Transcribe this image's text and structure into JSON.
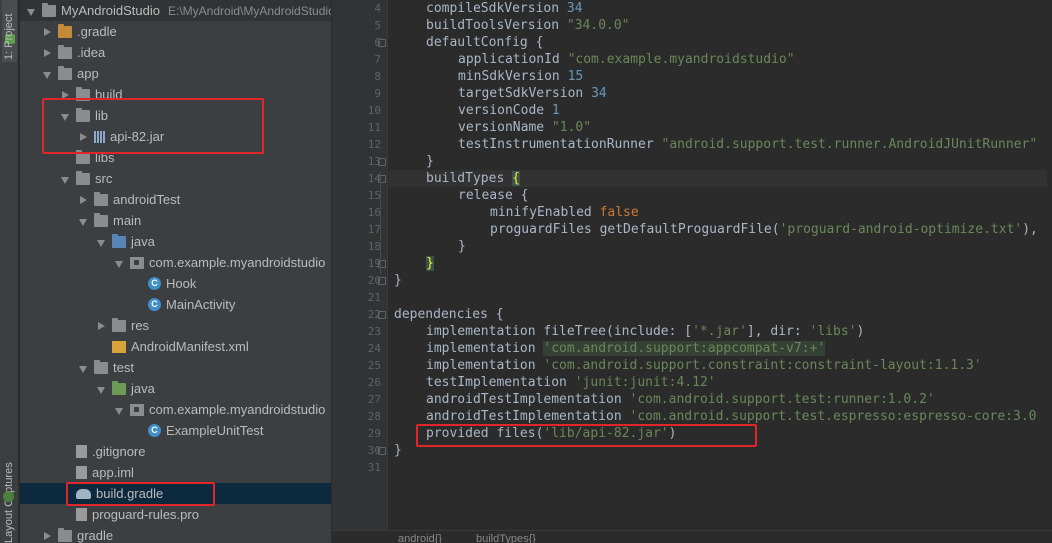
{
  "tool_strip": {
    "project_tab": "1: Project",
    "layout_captures_tab": "Layout Captures"
  },
  "project_tree": {
    "root": {
      "name": "MyAndroidStudio",
      "path": "E:\\MyAndroid\\MyAndroidStudio"
    },
    "rows": [
      {
        "label": ".gradle"
      },
      {
        "label": ".idea"
      },
      {
        "label": "app"
      },
      {
        "label": "build"
      },
      {
        "label": "lib"
      },
      {
        "label": "api-82.jar"
      },
      {
        "label": "libs"
      },
      {
        "label": "src"
      },
      {
        "label": "androidTest"
      },
      {
        "label": "main"
      },
      {
        "label": "java"
      },
      {
        "label": "com.example.myandroidstudio"
      },
      {
        "label": "Hook"
      },
      {
        "label": "MainActivity"
      },
      {
        "label": "res"
      },
      {
        "label": "AndroidManifest.xml"
      },
      {
        "label": "test"
      },
      {
        "label": "java"
      },
      {
        "label": "com.example.myandroidstudio"
      },
      {
        "label": "ExampleUnitTest"
      },
      {
        "label": ".gitignore"
      },
      {
        "label": "app.iml"
      },
      {
        "label": "build.gradle"
      },
      {
        "label": "proguard-rules.pro"
      },
      {
        "label": "gradle"
      }
    ],
    "class_badge": "C"
  },
  "editor": {
    "line_numbers": [
      "4",
      "5",
      "6",
      "7",
      "8",
      "9",
      "10",
      "11",
      "12",
      "13",
      "14",
      "15",
      "16",
      "17",
      "18",
      "19",
      "20",
      "21",
      "22",
      "23",
      "24",
      "25",
      "26",
      "27",
      "28",
      "29",
      "30",
      "31"
    ],
    "code": {
      "l4": [
        "compileSdkVersion ",
        "34"
      ],
      "l5": [
        "buildToolsVersion ",
        "\"34.0.0\""
      ],
      "l6": [
        "defaultConfig {"
      ],
      "l7": [
        "applicationId ",
        "\"com.example.myandroidstudio\""
      ],
      "l8": [
        "minSdkVersion ",
        "15"
      ],
      "l9": [
        "targetSdkVersion ",
        "34"
      ],
      "l10": [
        "versionCode ",
        "1"
      ],
      "l11": [
        "versionName ",
        "\"1.0\""
      ],
      "l12": [
        "testInstrumentationRunner ",
        "\"android.support.test.runner.AndroidJUnitRunner\""
      ],
      "l13": [
        "}"
      ],
      "l14": [
        "buildTypes ",
        "{"
      ],
      "l15": [
        "release {"
      ],
      "l16": [
        "minifyEnabled ",
        "false"
      ],
      "l17": [
        "proguardFiles getDefaultProguardFile(",
        "'proguard-android-optimize.txt'",
        "),"
      ],
      "l18": [
        "}"
      ],
      "l19": [
        "}"
      ],
      "l20": [
        "}"
      ],
      "l21": [
        ""
      ],
      "l22": [
        "dependencies {"
      ],
      "l23": [
        "implementation fileTree(include: [",
        "'*.jar'",
        "], dir: ",
        "'libs'",
        ")"
      ],
      "l24": [
        "implementation ",
        "'com.android.support:appcompat-v7:+'"
      ],
      "l25": [
        "implementation ",
        "'com.android.support.constraint:constraint-layout:1.1.3'"
      ],
      "l26": [
        "testImplementation ",
        "'junit:junit:4.12'"
      ],
      "l27": [
        "androidTestImplementation ",
        "'com.android.support.test:runner:1.0.2'"
      ],
      "l28": [
        "androidTestImplementation ",
        "'com.android.support.test.espresso:espresso-core:3.0"
      ],
      "l29": [
        "provided files(",
        "'lib/api-82.jar'",
        ")"
      ],
      "l30": [
        "}"
      ],
      "l31": [
        ""
      ]
    }
  },
  "breadcrumb": {
    "first": "android{}",
    "second": "buildTypes{}"
  },
  "colors": {
    "annotation": "#e0262a",
    "keyword": "#cc7832",
    "string": "#6a8759",
    "number": "#6897bb"
  }
}
